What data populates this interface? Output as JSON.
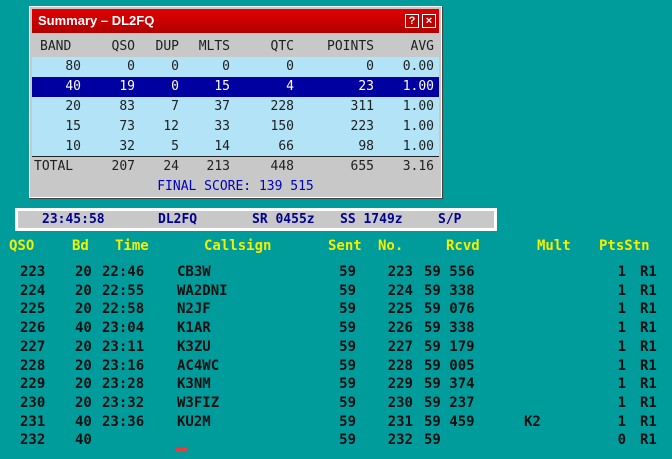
{
  "summary": {
    "title": "Summary – DL2FQ",
    "help_label": "?",
    "close_label": "×",
    "headers": {
      "band": "BAND",
      "qso": "QSO",
      "dup": "DUP",
      "mlts": "MLTS",
      "qtc": "QTC",
      "points": "POINTS",
      "avg": "AVG"
    },
    "rows": [
      {
        "band": "80",
        "qso": "0",
        "dup": "0",
        "mlts": "0",
        "qtc": "0",
        "points": "0",
        "avg": "0.00"
      },
      {
        "band": "40",
        "qso": "19",
        "dup": "0",
        "mlts": "15",
        "qtc": "4",
        "points": "23",
        "avg": "1.00"
      },
      {
        "band": "20",
        "qso": "83",
        "dup": "7",
        "mlts": "37",
        "qtc": "228",
        "points": "311",
        "avg": "1.00"
      },
      {
        "band": "15",
        "qso": "73",
        "dup": "12",
        "mlts": "33",
        "qtc": "150",
        "points": "223",
        "avg": "1.00"
      },
      {
        "band": "10",
        "qso": "32",
        "dup": "5",
        "mlts": "14",
        "qtc": "66",
        "points": "98",
        "avg": "1.00"
      }
    ],
    "selected_index": 1,
    "total": {
      "band": "TOTAL",
      "qso": "207",
      "dup": "24",
      "mlts": "213",
      "qtc": "448",
      "points": "655",
      "avg": "3.16"
    },
    "final_score": "FINAL SCORE: 139 515"
  },
  "status": {
    "time": "23:45:58",
    "call": "DL2FQ",
    "sr": "SR 0455z",
    "ss": "SS 1749z",
    "mode": "S/P"
  },
  "log": {
    "headers": {
      "qso": "QSO",
      "bd": "Bd",
      "time": "Time",
      "callsign": "Callsign",
      "sent": "Sent",
      "no": "No.",
      "rcvd": "Rcvd",
      "mult": "Mult",
      "ptsstn": "PtsStn"
    },
    "rows": [
      {
        "qso": "223",
        "bd": "20",
        "time": "22:46",
        "call": "CB3W",
        "sent": "59",
        "no": "223",
        "rcvd": "59 556",
        "mult": "",
        "pts": "1",
        "stn": "R1"
      },
      {
        "qso": "224",
        "bd": "20",
        "time": "22:55",
        "call": "WA2DNI",
        "sent": "59",
        "no": "224",
        "rcvd": "59 338",
        "mult": "",
        "pts": "1",
        "stn": "R1"
      },
      {
        "qso": "225",
        "bd": "20",
        "time": "22:58",
        "call": "N2JF",
        "sent": "59",
        "no": "225",
        "rcvd": "59 076",
        "mult": "",
        "pts": "1",
        "stn": "R1"
      },
      {
        "qso": "226",
        "bd": "40",
        "time": "23:04",
        "call": "K1AR",
        "sent": "59",
        "no": "226",
        "rcvd": "59 338",
        "mult": "",
        "pts": "1",
        "stn": "R1"
      },
      {
        "qso": "227",
        "bd": "20",
        "time": "23:11",
        "call": "K3ZU",
        "sent": "59",
        "no": "227",
        "rcvd": "59 179",
        "mult": "",
        "pts": "1",
        "stn": "R1"
      },
      {
        "qso": "228",
        "bd": "20",
        "time": "23:16",
        "call": "AC4WC",
        "sent": "59",
        "no": "228",
        "rcvd": "59 005",
        "mult": "",
        "pts": "1",
        "stn": "R1"
      },
      {
        "qso": "229",
        "bd": "20",
        "time": "23:28",
        "call": "K3NM",
        "sent": "59",
        "no": "229",
        "rcvd": "59 374",
        "mult": "",
        "pts": "1",
        "stn": "R1"
      },
      {
        "qso": "230",
        "bd": "20",
        "time": "23:32",
        "call": "W3FIZ",
        "sent": "59",
        "no": "230",
        "rcvd": "59 237",
        "mult": "",
        "pts": "1",
        "stn": "R1"
      },
      {
        "qso": "231",
        "bd": "40",
        "time": "23:36",
        "call": "KU2M",
        "sent": "59",
        "no": "231",
        "rcvd": "59 459",
        "mult": "K2",
        "pts": "1",
        "stn": "R1"
      },
      {
        "qso": "232",
        "bd": "40",
        "time": "",
        "call": "",
        "sent": "59",
        "no": "232",
        "rcvd": "59",
        "mult": "",
        "pts": "0",
        "stn": "R1"
      }
    ]
  }
}
